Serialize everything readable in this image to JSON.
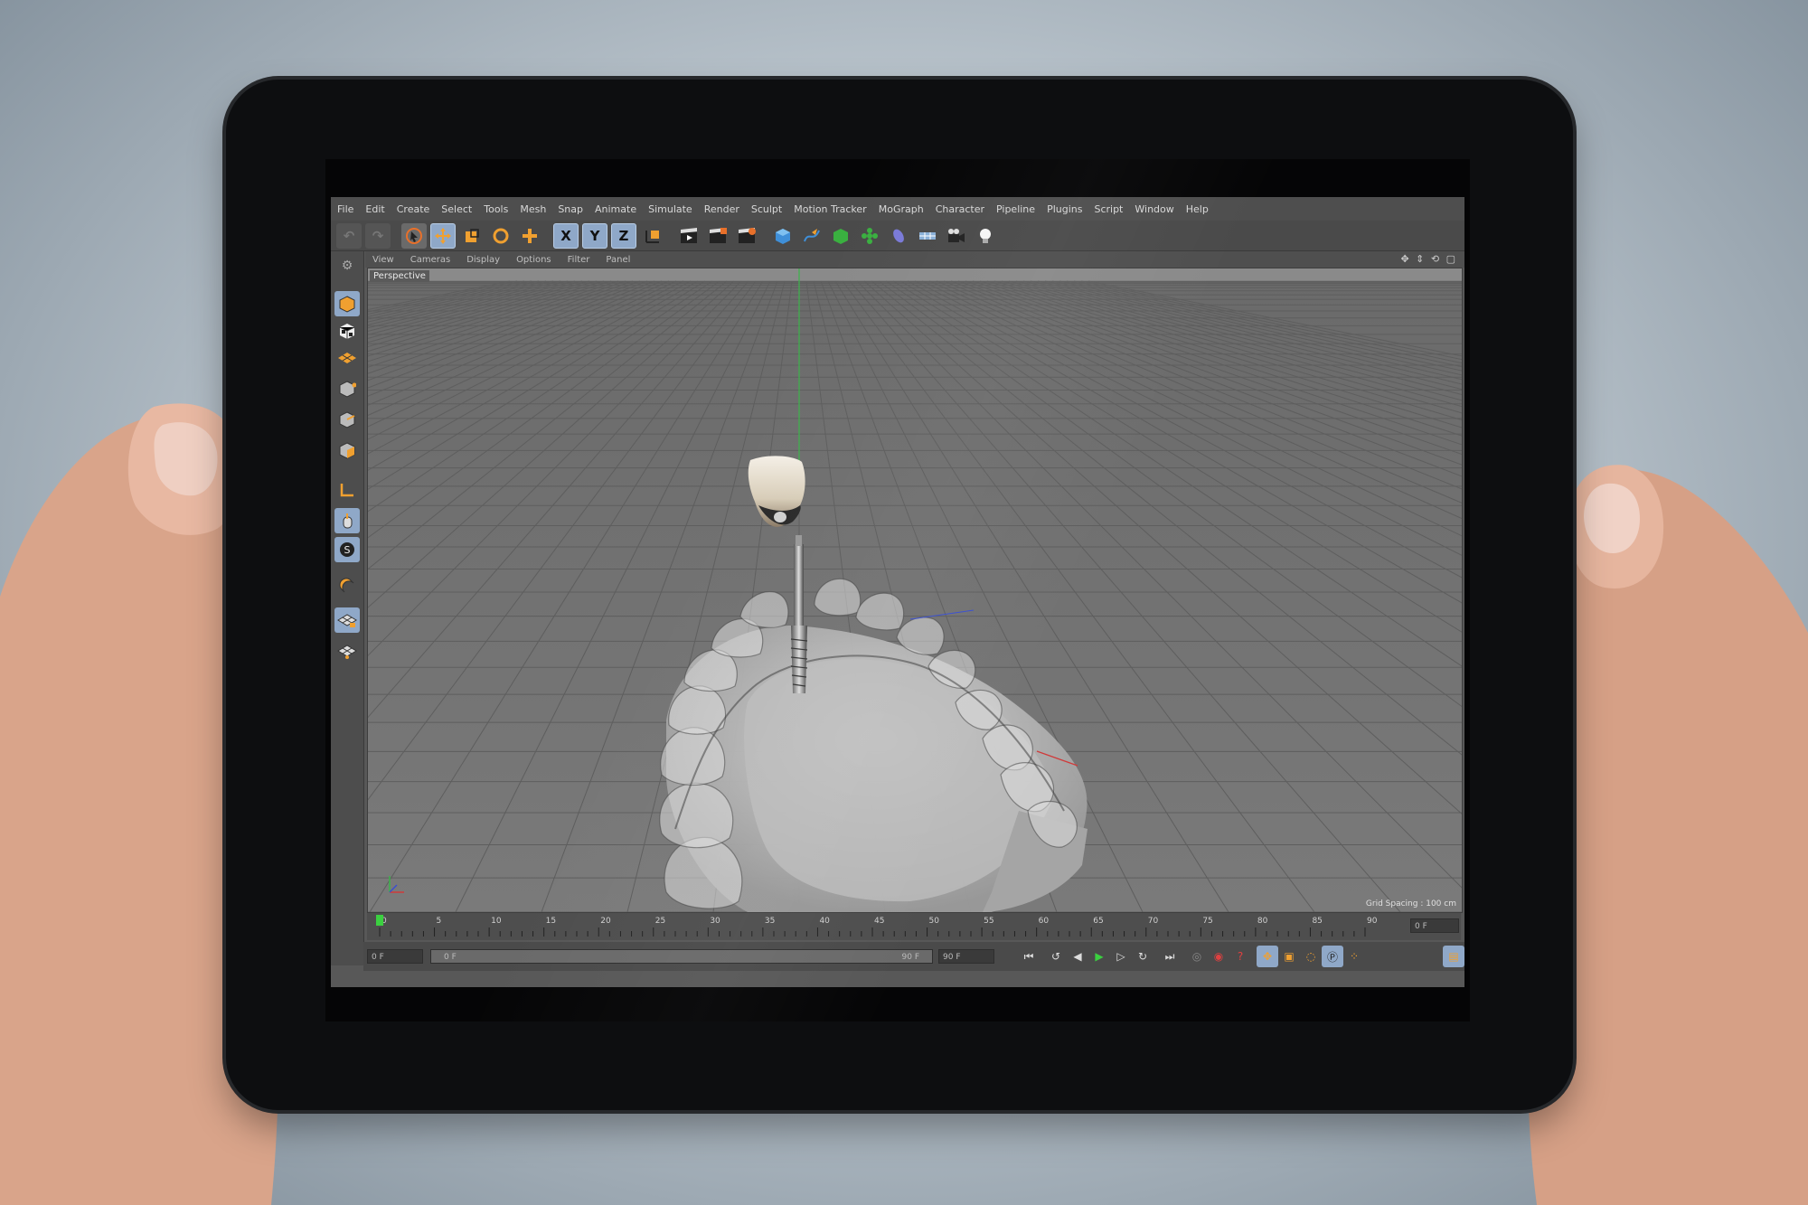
{
  "menu": [
    "File",
    "Edit",
    "Create",
    "Select",
    "Tools",
    "Mesh",
    "Snap",
    "Animate",
    "Simulate",
    "Render",
    "Sculpt",
    "Motion Tracker",
    "MoGraph",
    "Character",
    "Pipeline",
    "Plugins",
    "Script",
    "Window",
    "Help"
  ],
  "toolbar": {
    "axis_x": "X",
    "axis_y": "Y",
    "axis_z": "Z",
    "icons": [
      "undo-icon",
      "redo-icon",
      "live-select-icon",
      "move-icon",
      "scale-icon",
      "rotate-icon",
      "add-object-icon",
      "x-axis-lock",
      "y-axis-lock",
      "z-axis-lock",
      "coordinate-system-icon",
      "render-view-icon",
      "render-picture-viewer-icon",
      "render-settings-icon",
      "cube-primitive-icon",
      "spline-pen-icon",
      "subdivision-surface-icon",
      "cloner-icon",
      "deformer-icon",
      "floor-icon",
      "camera-icon",
      "light-icon"
    ]
  },
  "viewport_menu": [
    "View",
    "Cameras",
    "Display",
    "Options",
    "Filter",
    "Panel"
  ],
  "viewport": {
    "label": "Perspective",
    "grid_spacing": "Grid Spacing : 100 cm",
    "grid_color": "#5e5e5e",
    "bg_color": "#737373"
  },
  "timeline": {
    "ticks": [
      "0",
      "5",
      "10",
      "15",
      "20",
      "25",
      "30",
      "35",
      "40",
      "45",
      "50",
      "55",
      "60",
      "65",
      "70",
      "75",
      "80",
      "85",
      "90"
    ],
    "current_frame_field": "0 F",
    "start_field": "0 F",
    "range_start": "0 F",
    "range_end": "90 F",
    "end_field": "90 F",
    "current_frame_right": "0 F"
  },
  "accent": "#8fa8c8"
}
